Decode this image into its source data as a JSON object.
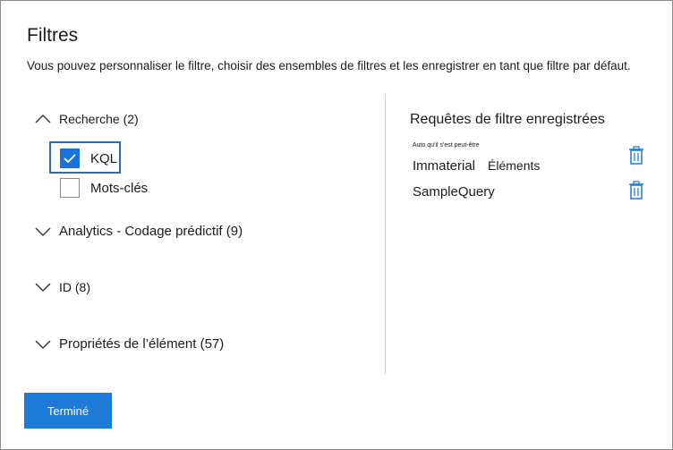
{
  "dialog": {
    "title": "Filtres",
    "description": "Vous pouvez personnaliser le filtre, choisir des ensembles de filtres et les enregistrer en tant que filtre par défaut."
  },
  "groups": [
    {
      "label": "Recherche (2)",
      "expanded": true
    },
    {
      "label": "Analytics - Codage prédictif (9)",
      "expanded": false
    },
    {
      "label": "ID (8)",
      "expanded": false
    },
    {
      "label": "Propriétés de l’élément (57)",
      "expanded": false
    }
  ],
  "search_options": [
    {
      "label": "KQL",
      "checked": true
    },
    {
      "label": "Mots-clés",
      "checked": false
    }
  ],
  "saved": {
    "title": "Requêtes de filtre enregistrées",
    "note": "Auto qu'il s'est peut-être",
    "queries": [
      {
        "name": "Immaterial",
        "sub": "Éléments"
      },
      {
        "name": "SampleQuery",
        "sub": ""
      }
    ]
  },
  "footer": {
    "done_label": "Terminé"
  },
  "colors": {
    "accent": "#1e7ad7",
    "checkbox": "#1a73d9",
    "focus_border": "#2b6cb0"
  },
  "icons": {
    "expanded": "chevron-up-icon",
    "collapsed": "chevron-down-icon",
    "delete": "trash-icon",
    "check": "checkmark-icon"
  }
}
